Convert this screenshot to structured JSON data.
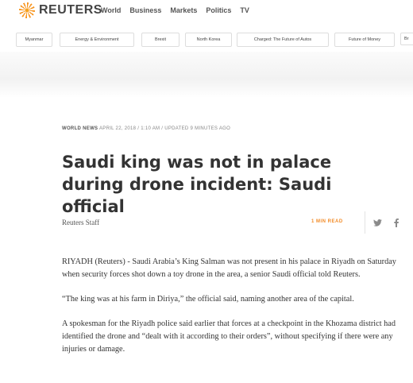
{
  "header": {
    "brand": "REUTERS",
    "nav": [
      "World",
      "Business",
      "Markets",
      "Politics",
      "TV"
    ]
  },
  "topics": [
    "Myanmar",
    "Energy & Environment",
    "Brexit",
    "North Korea",
    "Charged: The Future of Autos",
    "Future of Money",
    "Br"
  ],
  "article": {
    "section": "WORLD NEWS",
    "meta": "APRIL 22, 2018 / 1:10 AM / UPDATED 9 MINUTES AGO",
    "headline": "Saudi king was not in palace during drone incident: Saudi official",
    "byline": "Reuters Staff",
    "read_time": "1 MIN READ",
    "paragraphs": [
      "RIYADH (Reuters) - Saudi Arabia’s King Salman was not present in his palace in Riyadh on Saturday when security forces shot down a toy drone in the area, a senior Saudi official told Reuters.",
      "“The king was at his farm in Diriya,” the official said, naming another area of the capital.",
      "A spokesman for the Riyadh police said earlier that forces at a checkpoint in the Khozama district had identified the drone and “dealt with it according to their orders”, without specifying if there were any injuries or damage."
    ]
  },
  "icons": {
    "twitter": "twitter-icon",
    "facebook": "facebook-icon"
  },
  "colors": {
    "accent": "#f28c28",
    "logo": "#f7941d"
  }
}
